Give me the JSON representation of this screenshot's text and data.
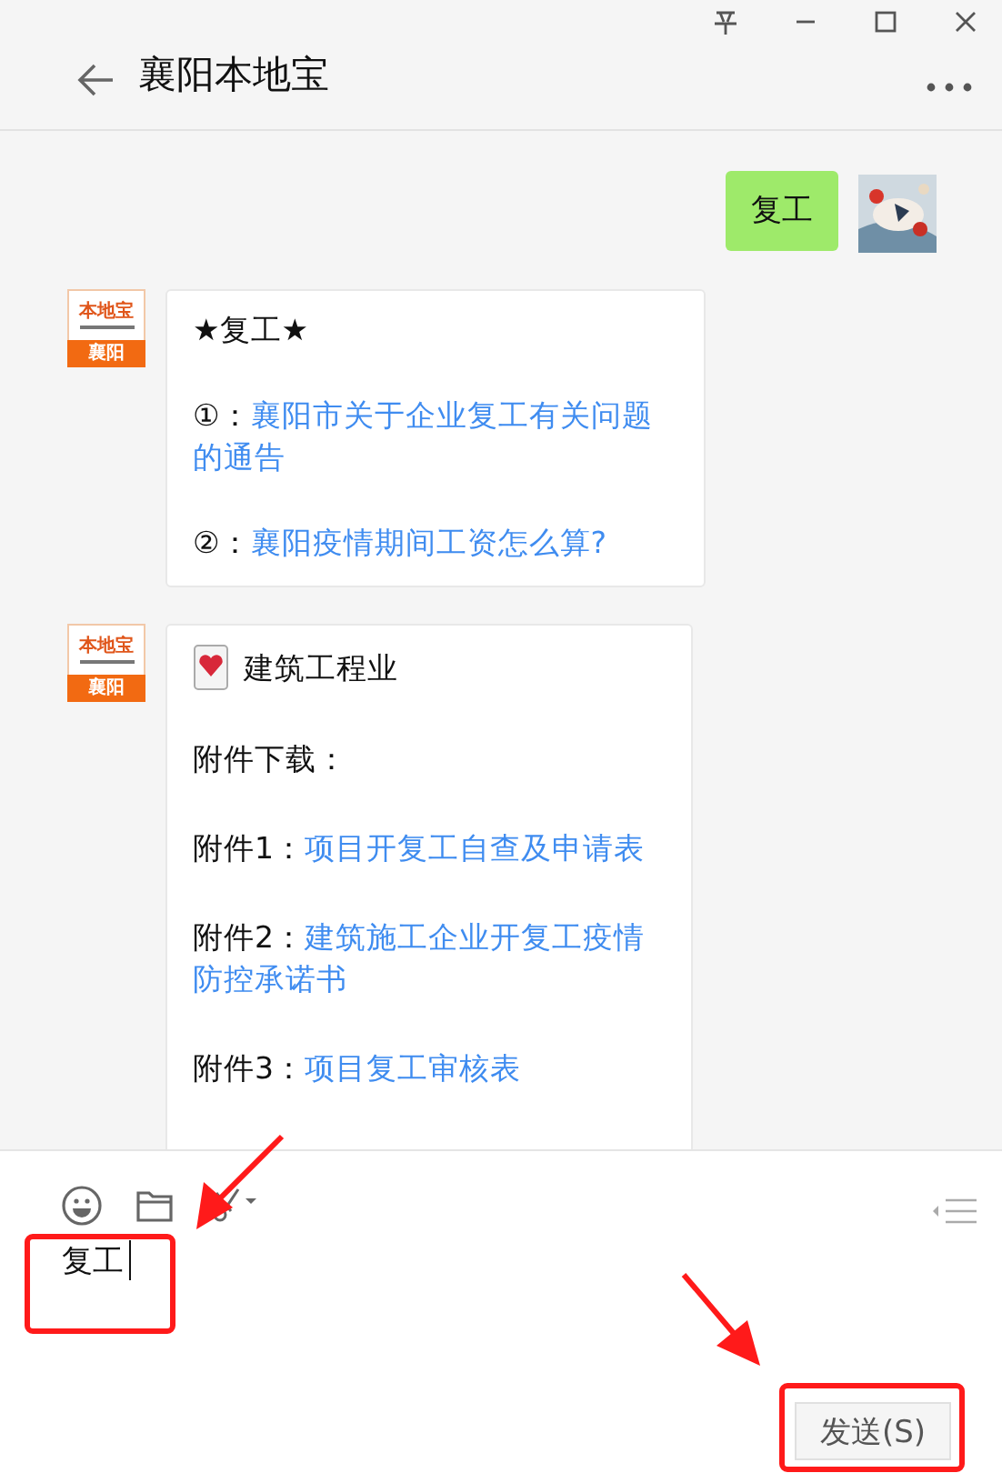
{
  "window": {
    "title": "襄阳本地宝"
  },
  "messages": [
    {
      "kind": "sent",
      "text": "复工"
    },
    {
      "kind": "received",
      "avatar": {
        "brand": "本地宝",
        "city": "襄阳"
      },
      "lines": [
        {
          "kind": "title",
          "text": "★复工★"
        },
        {
          "kind": "link",
          "prefix": "①：",
          "text": "襄阳市关于企业复工有关问题的通告"
        },
        {
          "kind": "link",
          "prefix": "②：",
          "text": "襄阳疫情期间工资怎么算?"
        }
      ]
    },
    {
      "kind": "received",
      "avatar": {
        "brand": "本地宝",
        "city": "襄阳"
      },
      "lines": [
        {
          "kind": "heading",
          "text": "建筑工程业"
        },
        {
          "kind": "plain",
          "text": "附件下载："
        },
        {
          "kind": "link",
          "prefix": "附件1：",
          "text": "项目开复工自查及申请表"
        },
        {
          "kind": "link",
          "prefix": "附件2：",
          "text": "建筑施工企业开复工疫情防控承诺书"
        },
        {
          "kind": "link",
          "prefix": "附件3：",
          "text": "项目复工审核表"
        }
      ]
    }
  ],
  "input": {
    "value": "复工"
  },
  "send_button": {
    "label": "发送(S)"
  }
}
